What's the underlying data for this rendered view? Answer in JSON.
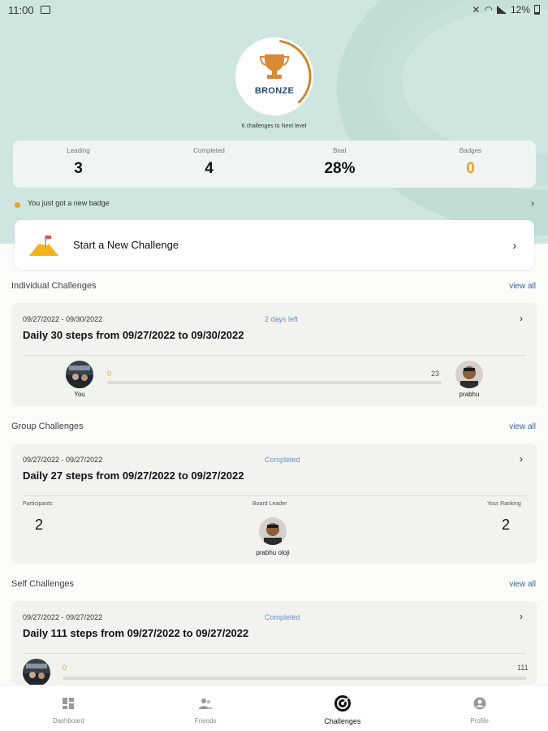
{
  "status_bar": {
    "time": "11:00",
    "battery": "12%"
  },
  "level": {
    "name": "BRONZE",
    "progress": 0.35,
    "note": "6 challenges to Next level"
  },
  "stats": [
    {
      "label": "Leading",
      "value": "3"
    },
    {
      "label": "Completed",
      "value": "4"
    },
    {
      "label": "Beat",
      "value": "28%"
    },
    {
      "label": "Badges",
      "value": "0"
    }
  ],
  "badge_note": "You just got a new badge",
  "new_challenge": {
    "label": "Start a New Challenge"
  },
  "sections": {
    "individual": {
      "title": "Individual Challenges",
      "view_all": "view all"
    },
    "group": {
      "title": "Group Challenges",
      "view_all": "view all"
    },
    "self": {
      "title": "Self Challenges",
      "view_all": "view all"
    }
  },
  "individual_card": {
    "dates": "09/27/2022 - 09/30/2022",
    "status": "2 days left",
    "title": "Daily 30 steps from 09/27/2022 to 09/30/2022",
    "progress_start": "0",
    "progress_end": "23",
    "progress": 0,
    "you_label": "You",
    "opponent_label": "prabhu"
  },
  "group_card": {
    "dates": "09/27/2022 - 09/27/2022",
    "status": "Completed",
    "title": "Daily 27 steps from 09/27/2022 to 09/27/2022",
    "participants_label": "Participants",
    "participants_value": "2",
    "leader_label": "Board Leader",
    "leader_name": "prabhu oloji",
    "ranking_label": "Your Ranking",
    "ranking_value": "2"
  },
  "self_card": {
    "dates": "09/27/2022 - 09/27/2022",
    "status": "Completed",
    "title": "Daily 111 steps from 09/27/2022 to 09/27/2022",
    "progress_start": "0",
    "progress_end": "111",
    "progress": 0
  },
  "nav": [
    {
      "label": "Dashboard",
      "icon": "dashboard-icon"
    },
    {
      "label": "Friends",
      "icon": "friends-icon"
    },
    {
      "label": "Challenges",
      "icon": "challenges-icon"
    },
    {
      "label": "Profile",
      "icon": "profile-icon"
    }
  ],
  "colors": {
    "hero": "#cfe6e0",
    "accent": "#e8a32a",
    "link": "#3a65a0",
    "status": "#6a8fd0"
  }
}
